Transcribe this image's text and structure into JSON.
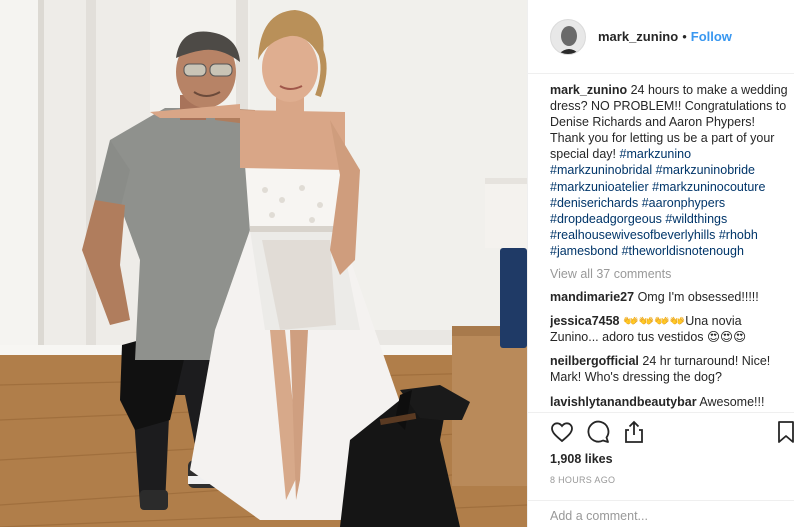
{
  "header": {
    "username": "mark_zunino",
    "separator": "•",
    "follow_label": "Follow"
  },
  "caption": {
    "username": "mark_zunino",
    "text": "24 hours to make a wedding dress? NO PROBLEM!! Congratulations to Denise Richards and Aaron Phypers! Thank you for letting us be a part of your special day!",
    "hashtags": [
      "#markzunino",
      "#markzuninobridal",
      "#markzuninobride",
      "#markzunioatelier",
      "#markzuninocouture",
      "#deniserichards",
      "#aaronphypers",
      "#dropdeadgorgeous",
      "#wildthings",
      "#realhousewivesofbeverlyhills",
      "#rhobh",
      "#jamesbond",
      "#theworldisnotenough"
    ]
  },
  "view_all_comments": "View all 37 comments",
  "comments": [
    {
      "username": "mandimarie27",
      "text": "Omg I'm obsessed!!!!!"
    },
    {
      "username": "jessica7458",
      "text": "👐👐👐👐Una novia Zunino... adoro tus vestidos 😍😍😍"
    },
    {
      "username": "neilbergofficial",
      "text": "24 hr turnaround! Nice! Mark! Who's dressing the dog?"
    },
    {
      "username": "lavishlytanandbeautybar",
      "text": "Awesome!!! Love her!!! And you of course. 😊"
    }
  ],
  "icons": {
    "like": "heart-icon",
    "comment": "comment-icon",
    "share": "share-icon",
    "save": "bookmark-icon"
  },
  "likes": "1,908 likes",
  "timestamp": "8 HOURS AGO",
  "add_comment": {
    "placeholder": "Add a comment..."
  },
  "colors": {
    "link": "#3897f0",
    "hashtag": "#003569",
    "muted": "#999999",
    "text": "#262626",
    "border": "#efefef"
  }
}
